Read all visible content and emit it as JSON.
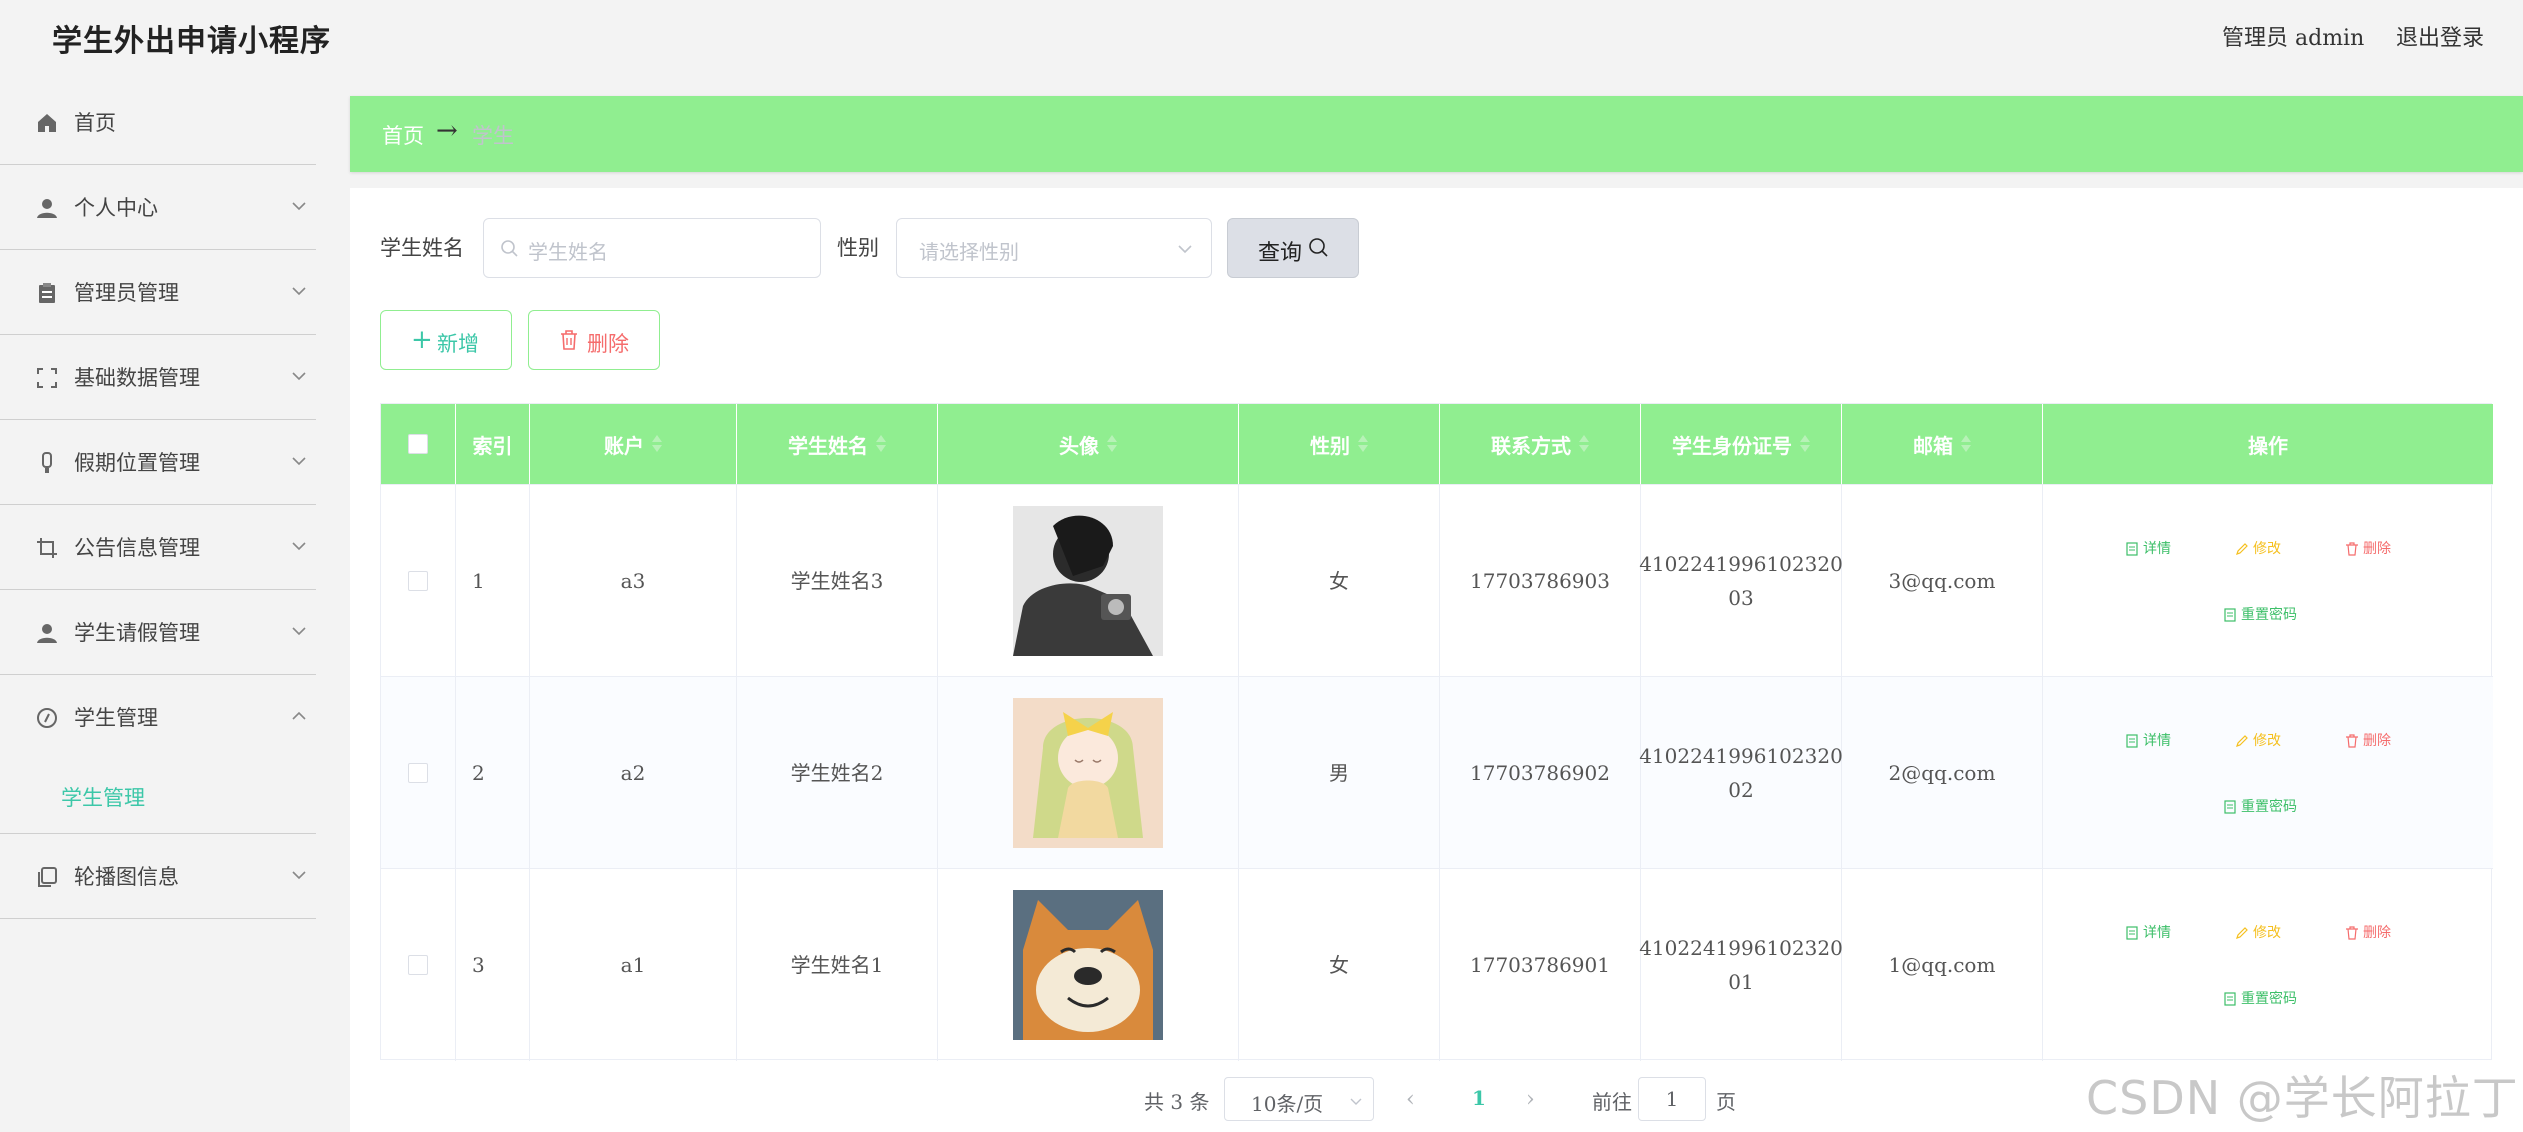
{
  "header": {
    "title": "学生外出申请小程序",
    "user": "管理员 admin",
    "logout": "退出登录"
  },
  "sidebar": {
    "items": [
      {
        "label": "首页",
        "icon": "home-icon"
      },
      {
        "label": "个人中心",
        "icon": "user-icon"
      },
      {
        "label": "管理员管理",
        "icon": "clipboard-icon"
      },
      {
        "label": "基础数据管理",
        "icon": "fullscreen-icon"
      },
      {
        "label": "假期位置管理",
        "icon": "mic-icon"
      },
      {
        "label": "公告信息管理",
        "icon": "crop-icon"
      },
      {
        "label": "学生请假管理",
        "icon": "user-icon"
      },
      {
        "label": "学生管理",
        "icon": "compass-icon"
      },
      {
        "label": "轮播图信息",
        "icon": "copy-icon"
      }
    ],
    "submenu": {
      "label": "学生管理"
    }
  },
  "breadcrumb": {
    "home": "首页",
    "separator": "→",
    "current": "学生"
  },
  "search": {
    "name_label": "学生姓名",
    "name_placeholder": "学生姓名",
    "gender_label": "性别",
    "gender_placeholder": "请选择性别",
    "query_label": "查询"
  },
  "actions": {
    "add_label": "新增",
    "delete_label": "删除"
  },
  "table": {
    "headers": {
      "index": "索引",
      "account": "账户",
      "name": "学生姓名",
      "avatar": "头像",
      "gender": "性别",
      "phone": "联系方式",
      "id_number": "学生身份证号",
      "email": "邮箱",
      "ops": "操作"
    },
    "rows": [
      {
        "index": "1",
        "account": "a3",
        "name": "学生姓名3",
        "gender": "女",
        "phone": "17703786903",
        "id_line1": "4102241996102320",
        "id_line2": "03",
        "email": "3@qq.com"
      },
      {
        "index": "2",
        "account": "a2",
        "name": "学生姓名2",
        "gender": "男",
        "phone": "17703786902",
        "id_line1": "4102241996102320",
        "id_line2": "02",
        "email": "2@qq.com"
      },
      {
        "index": "3",
        "account": "a1",
        "name": "学生姓名1",
        "gender": "女",
        "phone": "17703786901",
        "id_line1": "4102241996102320",
        "id_line2": "01",
        "email": "1@qq.com"
      }
    ],
    "ops": {
      "detail": "详情",
      "edit": "修改",
      "delete": "删除",
      "reset": "重置密码"
    }
  },
  "pagination": {
    "total": "共 3 条",
    "page_size": "10条/页",
    "current_page": "1",
    "goto_label": "前往",
    "goto_value": "1",
    "page_suffix": "页"
  },
  "watermark": "CSDN @学长阿拉丁",
  "colors": {
    "accent_green": "#90ee90",
    "teal": "#3cc7a8",
    "danger": "#f56c6c",
    "warning": "#f5c020",
    "success": "#3cbf68"
  }
}
